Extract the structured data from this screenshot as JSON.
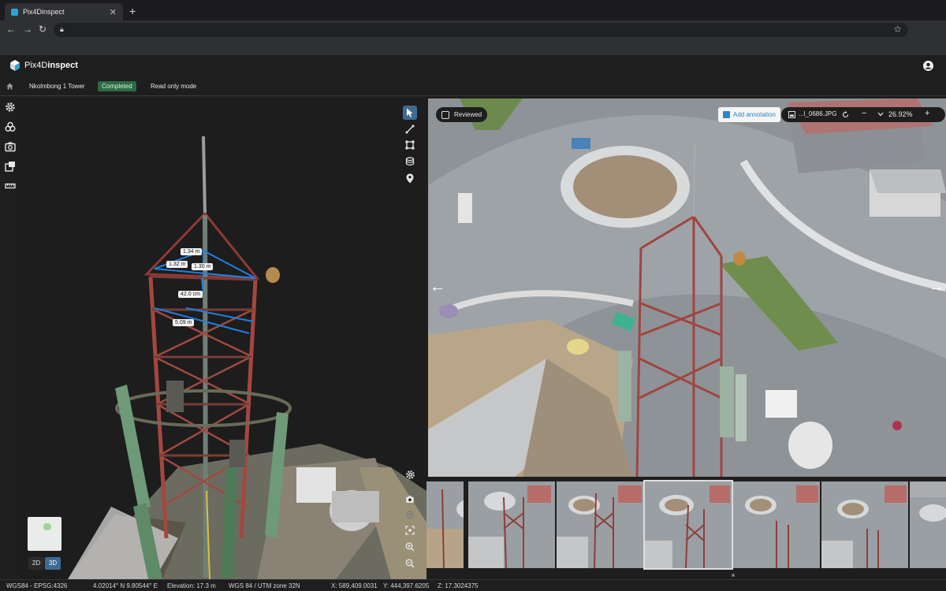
{
  "browser": {
    "tab_title": "Pix4Dinspect",
    "tab_close": "✕",
    "new_tab": "+"
  },
  "app": {
    "logo_regular": "Pix4D",
    "logo_bold": "inspect"
  },
  "breadcrumb": {
    "project": "Nkolmbong 1 Tower",
    "status": "Completed",
    "mode": "Read only mode"
  },
  "measurements": [
    {
      "label": "1.34 m"
    },
    {
      "label": "1.32 m"
    },
    {
      "label": "1.30 m"
    },
    {
      "label": "42.0 cm"
    },
    {
      "label": "5.09 m"
    }
  ],
  "view_toggle": {
    "two_d": "2D",
    "three_d": "3D",
    "active": "3D"
  },
  "image_viewer": {
    "reviewed_label": "Reviewed",
    "reviewed": false,
    "add_annotation": "Add annotation",
    "filename": "...l_0686.JPG",
    "zoom": "26.92%",
    "zoom_out": "−",
    "zoom_in": "+",
    "prev": "←",
    "next": "→"
  },
  "thumbnails": {
    "count": 7,
    "active_index": 3
  },
  "status": {
    "crs": "WGS84 - EPSG:4326",
    "coords": "4.02014° N 9.80544° E",
    "elevation": "Elevation: 17.3 m",
    "projected_crs": "WGS 84 / UTM zone 32N",
    "x": "X: 589,409.0031",
    "y": "Y: 444,397.6205",
    "z": "Z: 17.3024375"
  },
  "colors": {
    "accent": "#3f6b92",
    "badge_bg": "#2c6b46",
    "annotation_blue": "#2c86c9",
    "measure_blue": "#1f7fe0"
  }
}
